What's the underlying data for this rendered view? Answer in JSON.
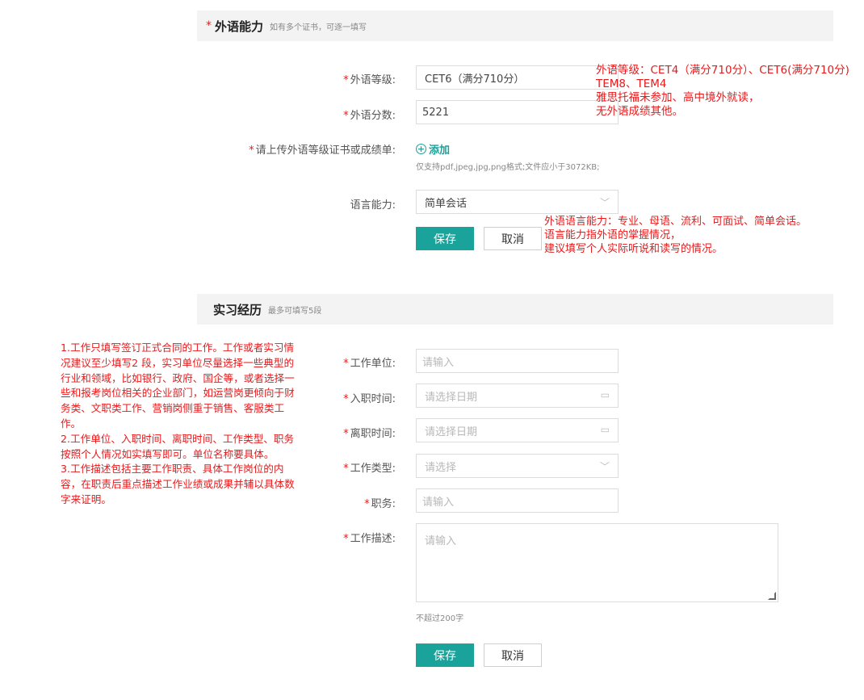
{
  "foreign_language": {
    "required_mark": "*",
    "title": "外语能力",
    "hint": "如有多个证书，可逐一填写",
    "level_label": "外语等级:",
    "level_value": "CET6（满分710分）",
    "score_label": "外语分数:",
    "score_value": "5221",
    "upload_label": "请上传外语等级证书或成绩单:",
    "add_label": "添加",
    "upload_hint": "仅支持pdf,jpeg,jpg,png格式;文件应小于3072KB;",
    "ability_label": "语言能力:",
    "ability_value": "简单会话",
    "save_label": "保存",
    "cancel_label": "取消"
  },
  "internship": {
    "title": "实习经历",
    "hint": "最多可填写5段",
    "employer_label": "工作单位:",
    "employer_placeholder": "请输入",
    "start_label": "入职时间:",
    "start_placeholder": "请选择日期",
    "end_label": "离职时间:",
    "end_placeholder": "请选择日期",
    "type_label": "工作类型:",
    "type_placeholder": "请选择",
    "position_label": "职务:",
    "position_placeholder": "请输入",
    "desc_label": "工作描述:",
    "desc_placeholder": "请输入",
    "desc_limit": "不超过200字",
    "save_label": "保存",
    "cancel_label": "取消"
  },
  "annotations": {
    "level_note": [
      "外语等级：CET4（满分710分）、CET6(满分710分)",
      "TEM8、TEM4",
      "雅思托福未参加、高中境外就读，",
      "无外语成绩其他。"
    ],
    "ability_note": [
      "外语语言能力：专业、母语、流利、可面试、简单会话。",
      "语言能力指外语的掌握情况，",
      "建议填写个人实际听说和读写的情况。"
    ],
    "internship_note": [
      "1.工作只填写签订正式合同的工作。工作或者实习情",
      "况建议至少填写2 段，实习单位尽量选择一些典型的",
      "行业和领域，比如银行、政府、国企等，或者选择一",
      "些和报考岗位相关的企业部门，如运营岗更倾向于财",
      "务类、文职类工作、营销岗侧重于销售、客服类工",
      "作。",
      "2.工作单位、入职时间、离职时间、工作类型、职务",
      "按照个人情况如实填写即可。单位名称要具体。",
      "3.工作描述包括主要工作职责、具体工作岗位的内",
      "容，在职责后重点描述工作业绩或成果并辅以具体数",
      "字来证明。"
    ]
  },
  "colors": {
    "accent": "#1aa39a",
    "required": "#e02020",
    "note": "#e8191b"
  }
}
